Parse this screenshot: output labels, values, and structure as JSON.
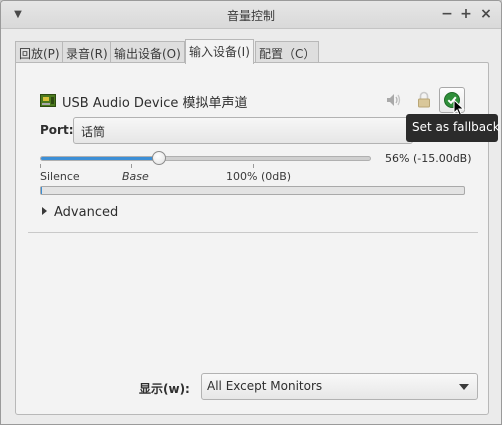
{
  "window": {
    "title": "音量控制",
    "menu_icon": "chevron-down-icon",
    "minimize_label": "−",
    "maximize_label": "+",
    "close_label": "×"
  },
  "tabs": [
    {
      "label": "回放(P)",
      "active": false
    },
    {
      "label": "录音(R)",
      "active": false
    },
    {
      "label": "输出设备(O)",
      "active": false
    },
    {
      "label": "输入设备(I)",
      "active": true
    },
    {
      "label": "配置（C）",
      "active": false
    }
  ],
  "device": {
    "name": "USB Audio Device 模拟单声道",
    "port_label": "Port:",
    "port_value": "话筒",
    "volume_text": "56% (-15.00dB)",
    "volume_percent": 56,
    "marks": {
      "silence": "Silence",
      "base": "Base",
      "full": "100% (0dB)"
    },
    "level_fraction": 0.002,
    "fallback_tooltip": "Set as fallback",
    "icons": {
      "device": "sound-card-icon",
      "mute": "speaker-icon",
      "lock": "lock-icon",
      "fallback": "checkmark-icon"
    }
  },
  "advanced_label": "Advanced",
  "footer": {
    "show_label": "显示(w):",
    "show_value": "All Except Monitors"
  },
  "colors": {
    "accent": "#3c8fd6",
    "fallback_green": "#2f8f3a",
    "tooltip_bg": "#2b2b2b"
  }
}
